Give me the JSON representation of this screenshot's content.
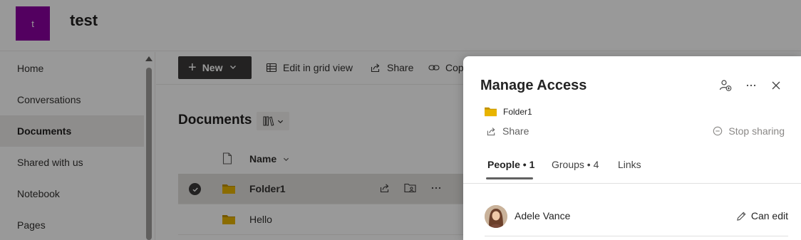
{
  "site": {
    "logo_letter": "t",
    "title": "test",
    "logo_color": "#8a00a0"
  },
  "leftnav": {
    "items": [
      {
        "label": "Home",
        "selected": false
      },
      {
        "label": "Conversations",
        "selected": false
      },
      {
        "label": "Documents",
        "selected": true
      },
      {
        "label": "Shared with us",
        "selected": false
      },
      {
        "label": "Notebook",
        "selected": false
      },
      {
        "label": "Pages",
        "selected": false
      }
    ]
  },
  "commandbar": {
    "new_label": "New",
    "edit_grid_label": "Edit in grid view",
    "share_label": "Share",
    "copy_link_label": "Cop"
  },
  "library": {
    "title": "Documents",
    "column_name": "Name",
    "rows": [
      {
        "name": "Folder1",
        "selected": true
      },
      {
        "name": "Hello",
        "selected": false
      }
    ]
  },
  "panel": {
    "title": "Manage Access",
    "item_name": "Folder1",
    "share_label": "Share",
    "stop_sharing_label": "Stop sharing",
    "tabs": [
      {
        "label": "People • 1",
        "active": true
      },
      {
        "label": "Groups • 4",
        "active": false
      },
      {
        "label": "Links",
        "active": false
      }
    ],
    "people": [
      {
        "name": "Adele Vance",
        "permission": "Can edit"
      }
    ]
  },
  "colors": {
    "folder": "#e8b400",
    "accent_dark": "#3b3a39"
  }
}
